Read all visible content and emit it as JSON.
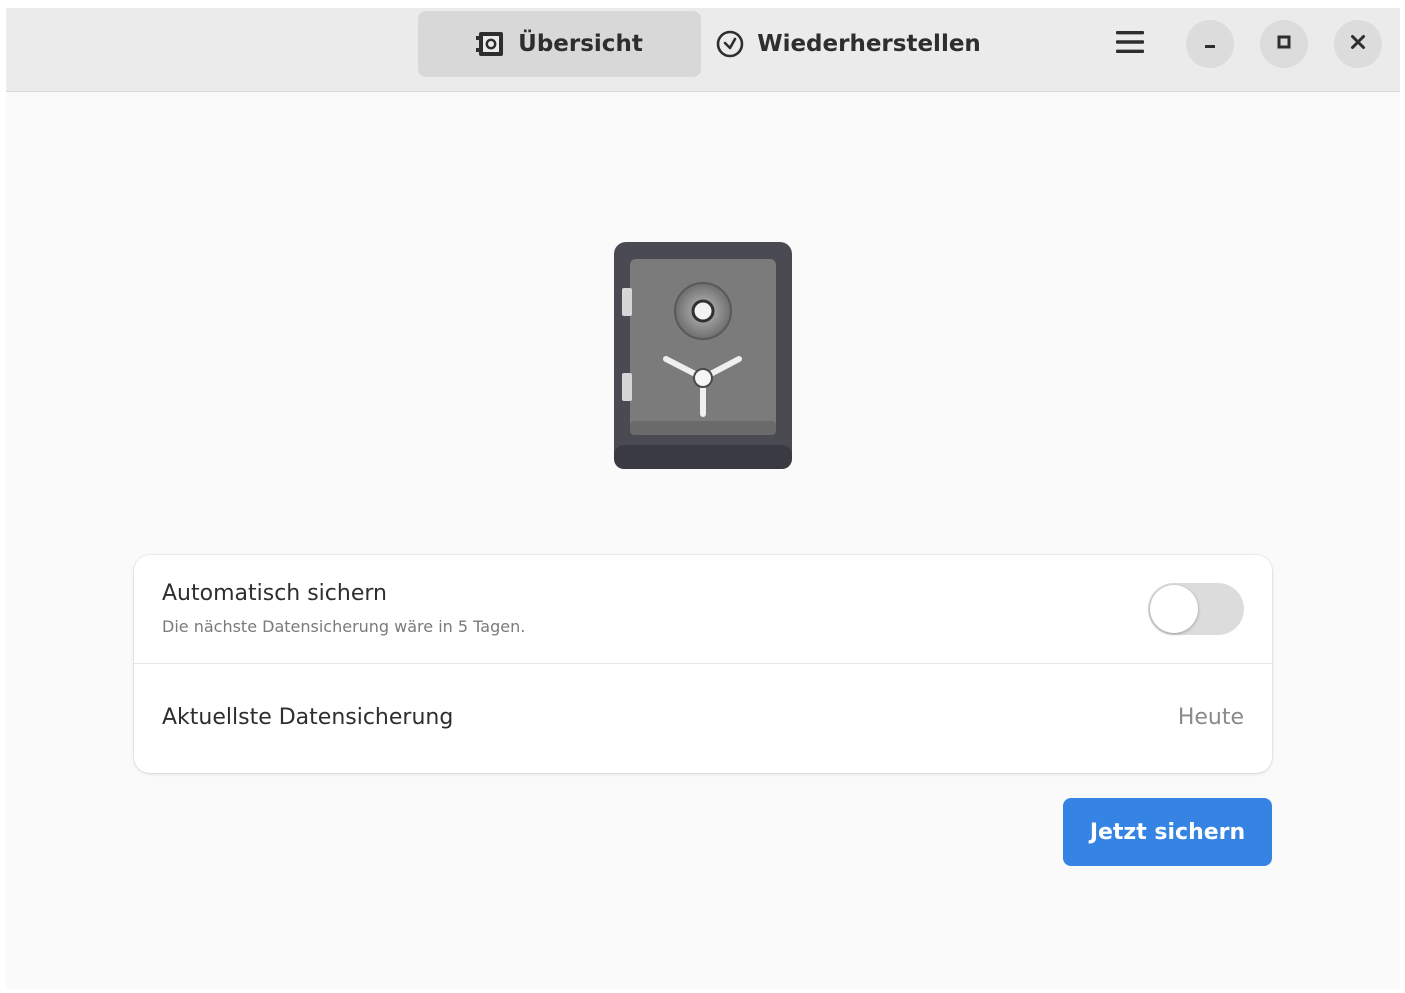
{
  "header": {
    "tabs": [
      {
        "label": "Übersicht",
        "icon": "safe-icon",
        "active": true
      },
      {
        "label": "Wiederherstellen",
        "icon": "clock-icon",
        "active": false
      }
    ],
    "menu_icon": "hamburger-menu-icon",
    "window_controls": [
      "minimize-icon",
      "maximize-icon",
      "close-icon"
    ]
  },
  "main": {
    "illustration": "safe-illustration",
    "settings": {
      "auto_backup": {
        "title": "Automatisch sichern",
        "subtitle": "Die nächste Datensicherung wäre in 5 Tagen.",
        "enabled": false
      },
      "latest_backup": {
        "title": "Aktuellste Datensicherung",
        "value": "Heute"
      }
    },
    "primary_action": "Jetzt sichern"
  },
  "colors": {
    "accent": "#3584e4",
    "headerbar": "#ebebeb",
    "window_background": "#fafafa"
  }
}
